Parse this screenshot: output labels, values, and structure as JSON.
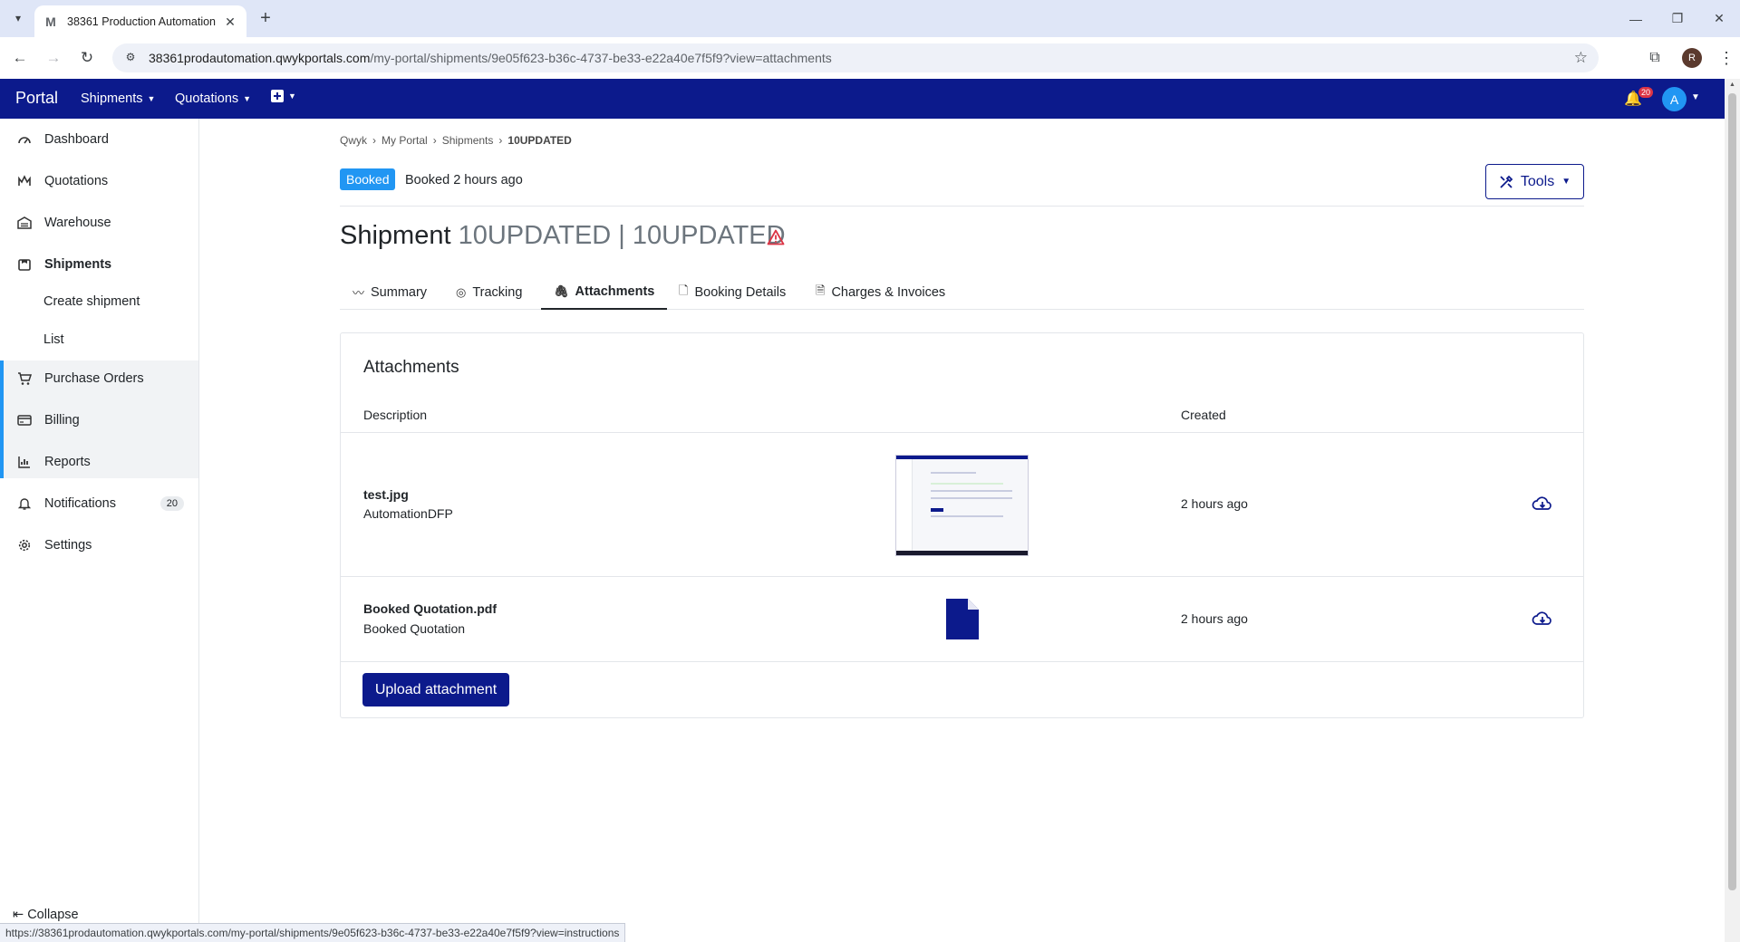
{
  "browser": {
    "tab_title": "38361 Production Automation",
    "url_host": "38361prodautomation.qwykportals.com",
    "url_path": "/my-portal/shipments/9e05f623-b36c-4737-be33-e22a40e7f5f9?view=attachments",
    "profile_initial": "R",
    "status_url": "https://38361prodautomation.qwykportals.com/my-portal/shipments/9e05f623-b36c-4737-be33-e22a40e7f5f9?view=instructions"
  },
  "appbar": {
    "brand": "Portal",
    "menus": [
      "Shipments",
      "Quotations"
    ],
    "notification_count": "20",
    "avatar_initial": "A"
  },
  "sidebar": {
    "items": [
      {
        "label": "Dashboard",
        "icon": "dashboard-icon"
      },
      {
        "label": "Quotations",
        "icon": "quotations-icon"
      },
      {
        "label": "Warehouse",
        "icon": "warehouse-icon"
      },
      {
        "label": "Shipments",
        "icon": "shipments-icon"
      },
      {
        "label": "Purchase Orders",
        "icon": "cart-icon"
      },
      {
        "label": "Billing",
        "icon": "billing-icon"
      },
      {
        "label": "Reports",
        "icon": "reports-icon"
      },
      {
        "label": "Notifications",
        "icon": "bell-icon",
        "badge": "20"
      },
      {
        "label": "Settings",
        "icon": "gear-icon"
      }
    ],
    "shipments_sub": [
      "Create shipment",
      "List"
    ],
    "collapse": "Collapse"
  },
  "breadcrumb": [
    "Qwyk",
    "My Portal",
    "Shipments",
    "10UPDATED"
  ],
  "status": {
    "badge": "Booked",
    "text": "Booked 2 hours ago"
  },
  "tools_label": "Tools",
  "title": {
    "prefix": "Shipment",
    "ref": "10UPDATED | 10UPDATED"
  },
  "tabs": [
    "Summary",
    "Tracking",
    "Attachments",
    "Booking Details",
    "Charges & Invoices"
  ],
  "attachments": {
    "title": "Attachments",
    "col_description": "Description",
    "col_created": "Created",
    "rows": [
      {
        "name": "test.jpg",
        "description": "AutomationDFP",
        "created": "2 hours ago"
      },
      {
        "name": "Booked Quotation.pdf",
        "description": "Booked Quotation",
        "created": "2 hours ago"
      }
    ],
    "upload_label": "Upload attachment"
  },
  "colors": {
    "primary": "#0c1a8c",
    "accent": "#2196f3",
    "danger": "#dc3545"
  }
}
